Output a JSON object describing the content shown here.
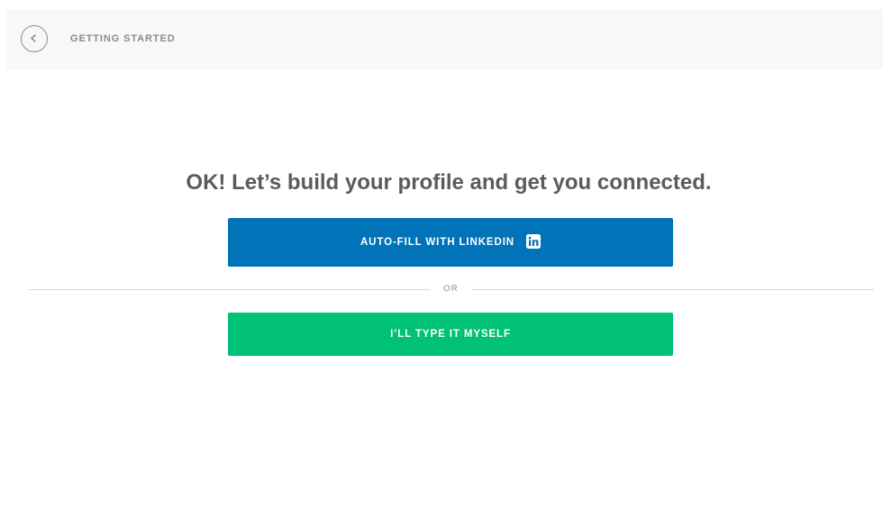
{
  "header": {
    "back_icon": "chevron-left-icon",
    "title": "GETTING STARTED"
  },
  "main": {
    "headline": "OK! Let’s build your profile and get you connected.",
    "linkedin_button": {
      "label": "AUTO-FILL WITH LINKEDIN",
      "icon": "linkedin-icon",
      "color": "#0073b9"
    },
    "divider_text": "OR",
    "self_button": {
      "label": "I’LL TYPE IT MYSELF",
      "color": "#00c176"
    }
  }
}
